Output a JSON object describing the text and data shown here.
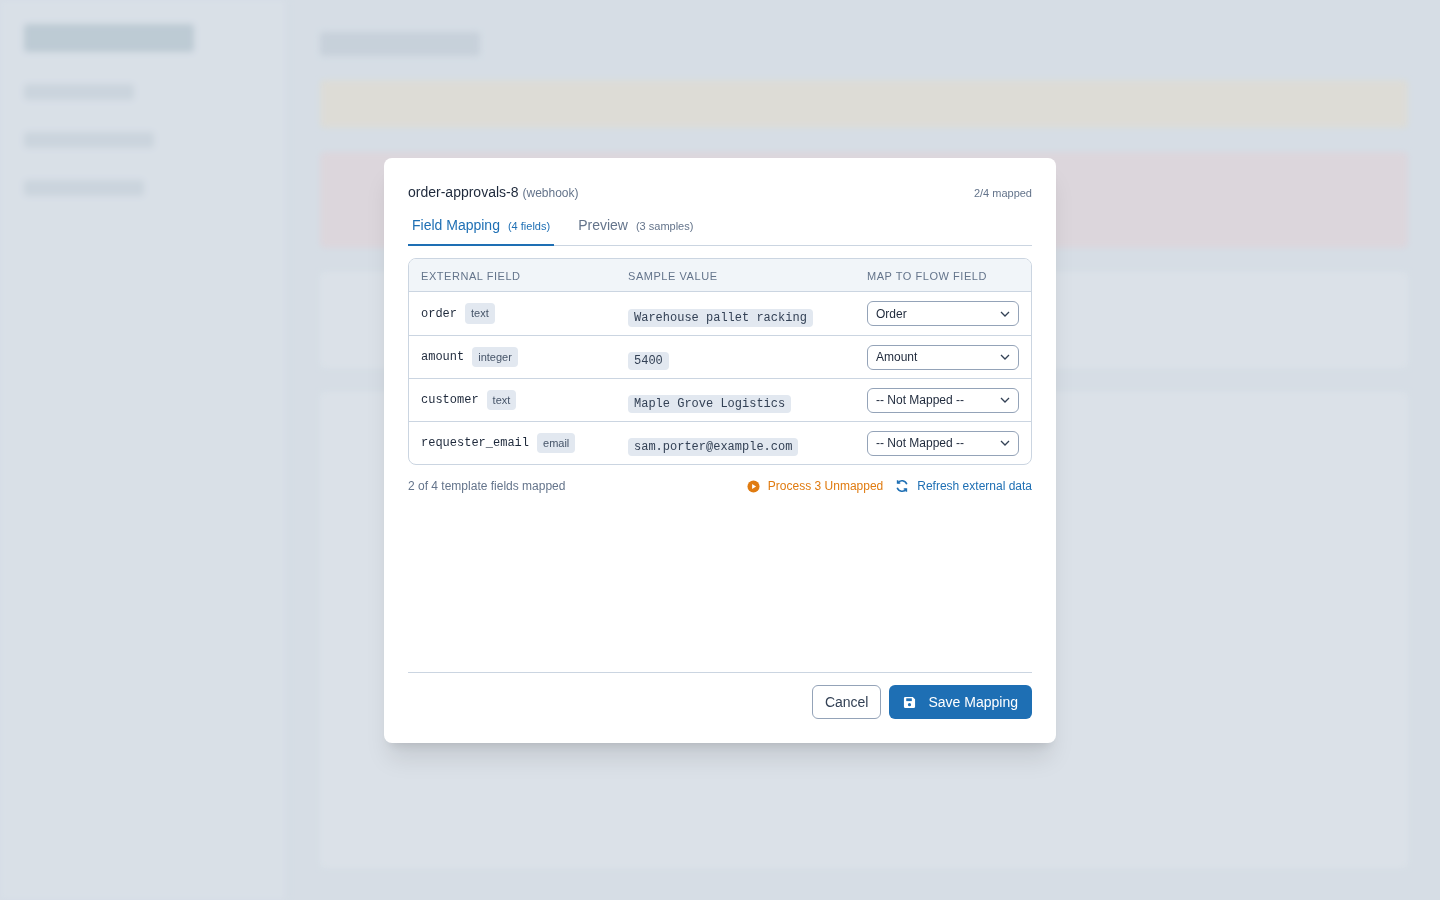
{
  "dialog": {
    "title": "order-approvals-8",
    "source_type": "(webhook)",
    "mapped_summary": "2/4 mapped"
  },
  "tabs": [
    {
      "label": "Field Mapping",
      "count": "(4 fields)",
      "selected": true
    },
    {
      "label": "Preview",
      "count": "(3 samples)",
      "selected": false
    }
  ],
  "table": {
    "columns": [
      "EXTERNAL FIELD",
      "SAMPLE VALUE",
      "MAP TO FLOW FIELD"
    ],
    "rows": [
      {
        "field": "order",
        "type": "text",
        "sample": "Warehouse pallet racking",
        "mapping": "Order"
      },
      {
        "field": "amount",
        "type": "integer",
        "sample": "5400",
        "mapping": "Amount"
      },
      {
        "field": "customer",
        "type": "text",
        "sample": "Maple Grove Logistics",
        "mapping": "-- Not Mapped --"
      },
      {
        "field": "requester_email",
        "type": "email",
        "sample": "sam.porter@example.com",
        "mapping": "-- Not Mapped --"
      }
    ]
  },
  "footer_note": "2 of 4 template fields mapped",
  "actions": [
    {
      "kind": "process",
      "label": "Process 3 Unmapped"
    },
    {
      "kind": "refresh",
      "label": "Refresh external data"
    }
  ],
  "buttons": [
    {
      "kind": "secondary",
      "label": "Cancel"
    },
    {
      "kind": "primary",
      "label": "Save Mapping"
    }
  ]
}
